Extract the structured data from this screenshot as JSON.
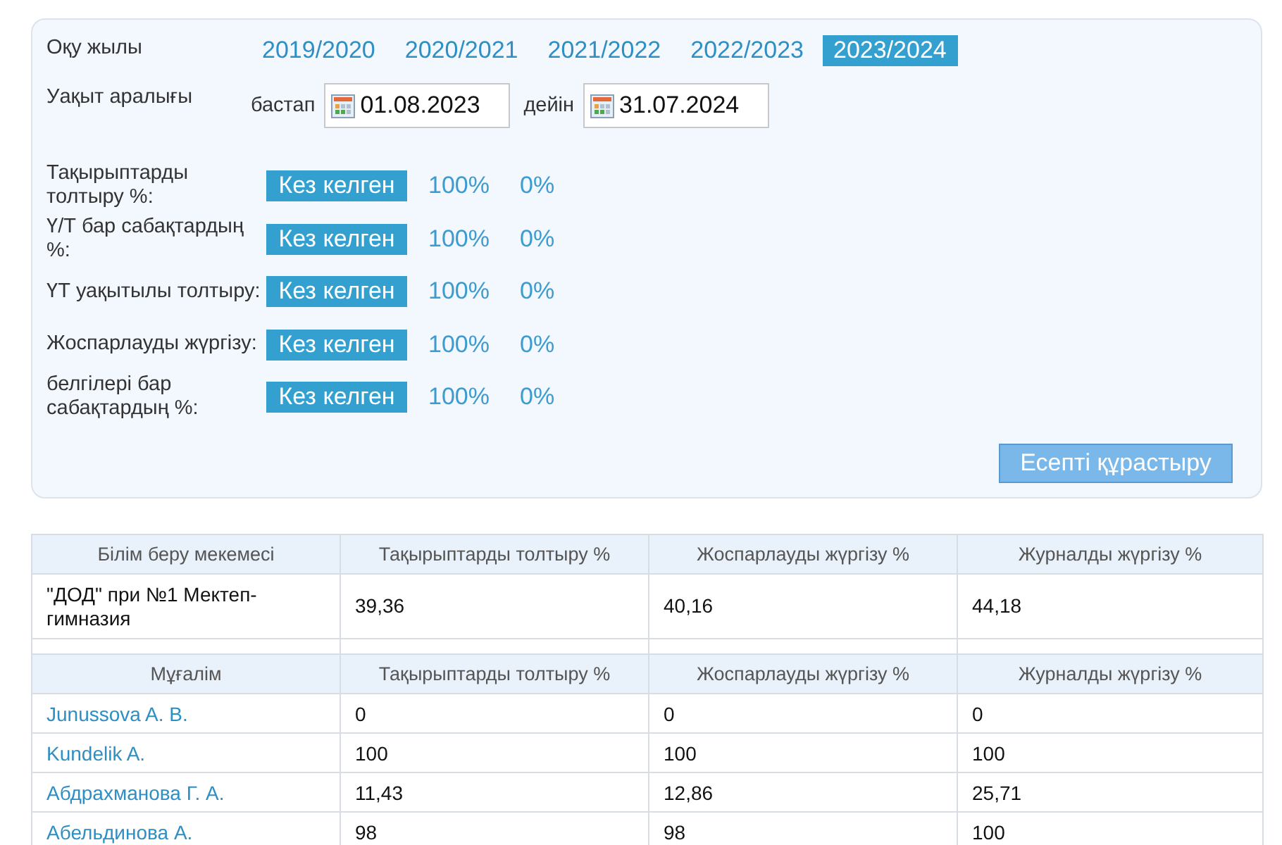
{
  "filter": {
    "year_label": "Оқу жылы",
    "years": [
      {
        "label": "2019/2020",
        "selected": false
      },
      {
        "label": "2020/2021",
        "selected": false
      },
      {
        "label": "2021/2022",
        "selected": false
      },
      {
        "label": "2022/2023",
        "selected": false
      },
      {
        "label": "2023/2024",
        "selected": true
      }
    ],
    "period_label": "Уақыт аралығы",
    "from_label": "бастап",
    "from_value": "01.08.2023",
    "to_label": "дейін",
    "to_value": "31.07.2024",
    "metrics": [
      {
        "label": "Тақырыптарды толтыру %:",
        "mode": "Кез келген",
        "max": "100%",
        "min": "0%"
      },
      {
        "label": "Ү/Т бар сабақтардың %:",
        "mode": "Кез келген",
        "max": "100%",
        "min": "0%"
      },
      {
        "label": "ҮТ уақытылы толтыру:",
        "mode": "Кез келген",
        "max": "100%",
        "min": "0%"
      },
      {
        "label": "Жоспарлауды жүргізу:",
        "mode": "Кез келген",
        "max": "100%",
        "min": "0%"
      },
      {
        "label": "белгілері бар сабақтардың %:",
        "mode": "Кез келген",
        "max": "100%",
        "min": "0%"
      }
    ],
    "submit": "Есепті құрастыру"
  },
  "school_table": {
    "columns": [
      "Білім беру мекемесі",
      "Тақырыптарды толтыру %",
      "Жоспарлауды жүргізу %",
      "Журналды жүргізу %"
    ],
    "rows": [
      [
        "\"ДОД\" при №1 Мектеп-гимназия",
        "39,36",
        "40,16",
        "44,18"
      ]
    ]
  },
  "teacher_table": {
    "columns": [
      "Мұғалім",
      "Тақырыптарды толтыру %",
      "Жоспарлауды жүргізу %",
      "Журналды жүргізу %"
    ],
    "rows": [
      [
        "Junussova A. B.",
        "0",
        "0",
        "0"
      ],
      [
        "Kundelik A.",
        "100",
        "100",
        "100"
      ],
      [
        "Абдрахманова Г. А.",
        "11,43",
        "12,86",
        "25,71"
      ],
      [
        "Абельдинова А.",
        "98",
        "98",
        "100"
      ]
    ]
  }
}
